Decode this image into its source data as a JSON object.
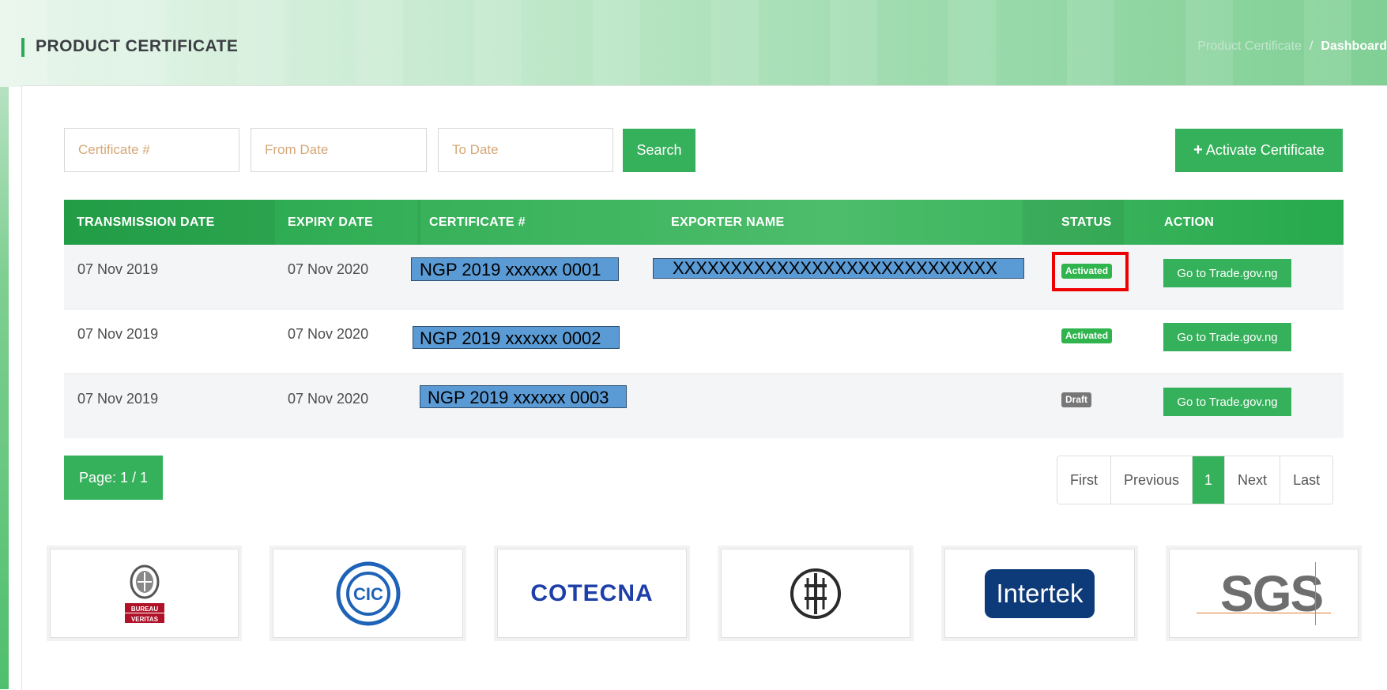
{
  "header": {
    "title": "PRODUCT CERTIFICATE",
    "breadcrumb": {
      "link": "Product Certificate",
      "separator": "/",
      "current": "Dashboard"
    }
  },
  "filters": {
    "certificate_placeholder": "Certificate #",
    "from_date_placeholder": "From Date",
    "to_date_placeholder": "To Date",
    "search_label": "Search",
    "activate_label": "Activate Certificate"
  },
  "table": {
    "columns": [
      "TRANSMISSION DATE",
      "EXPIRY DATE",
      "CERTIFICATE #",
      "EXPORTER NAME",
      "STATUS",
      "ACTION"
    ],
    "rows": [
      {
        "transmission_date": "07 Nov 2019",
        "expiry_date": "07 Nov 2020",
        "certificate": "NGP 2019 xxxxxx 0001",
        "exporter": "XXXXXXXXXXXXXXXXXXXXXXXXXXXX",
        "status": "Activated",
        "action": "Go to Trade.gov.ng"
      },
      {
        "transmission_date": "07 Nov 2019",
        "expiry_date": "07 Nov 2020",
        "certificate": "NGP 2019 xxxxxx 0002",
        "exporter": "",
        "status": "Activated",
        "action": "Go to Trade.gov.ng"
      },
      {
        "transmission_date": "07 Nov 2019",
        "expiry_date": "07 Nov 2020",
        "certificate": "NGP 2019 xxxxxx 0003",
        "exporter": "",
        "status": "Draft",
        "action": "Go to Trade.gov.ng"
      }
    ]
  },
  "pagination": {
    "indicator": "Page: 1 / 1",
    "first": "First",
    "previous": "Previous",
    "current": "1",
    "next": "Next",
    "last": "Last"
  },
  "logos": {
    "bureau_veritas": "BUREAU VERITAS",
    "cic": "CIC",
    "cotecna": "COTECNA",
    "intertek": "Intertek",
    "sgs": "SGS"
  },
  "colors": {
    "accent_green": "#35b05b",
    "status_activated": "#2fb44e",
    "status_draft": "#777777",
    "highlight_red": "#ee0000",
    "redaction_blue": "#5b9bd5"
  },
  "icons": [
    "plus-icon"
  ]
}
